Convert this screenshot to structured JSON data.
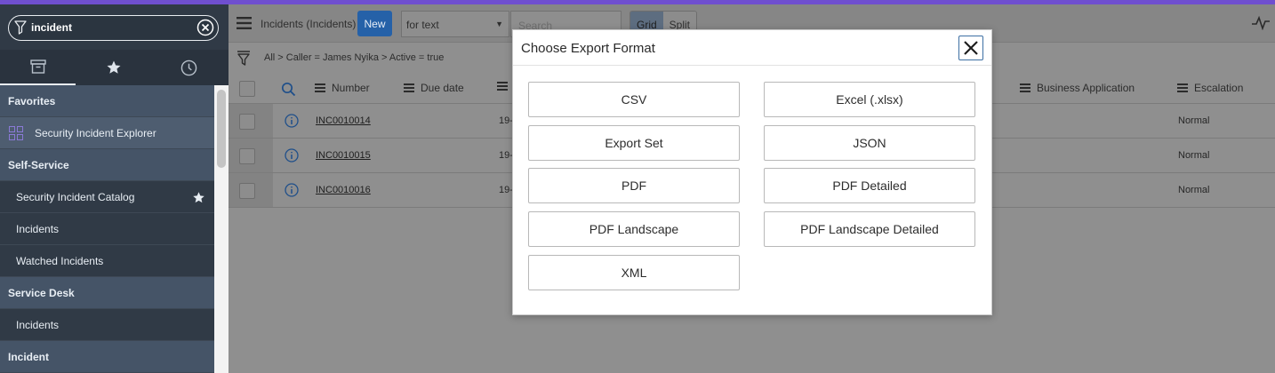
{
  "sidebar": {
    "filter_value": "incident",
    "tabs": [
      {
        "name": "all-apps",
        "icon": "archive-icon"
      },
      {
        "name": "favorites",
        "icon": "star-icon"
      },
      {
        "name": "history",
        "icon": "clock-icon"
      }
    ],
    "items": [
      {
        "label": "Favorites",
        "type": "section"
      },
      {
        "label": "Security Incident Explorer",
        "type": "item"
      },
      {
        "label": "Self-Service",
        "type": "section"
      },
      {
        "label": "Security Incident Catalog",
        "type": "item"
      },
      {
        "label": "Incidents",
        "type": "item"
      },
      {
        "label": "Watched Incidents",
        "type": "item"
      },
      {
        "label": "Service Desk",
        "type": "section"
      },
      {
        "label": "Incidents",
        "type": "item"
      },
      {
        "label": "Incident",
        "type": "section"
      }
    ]
  },
  "toolbar": {
    "list_title": "Incidents (Incidents)",
    "new_label": "New",
    "search_field": "for text",
    "search_placeholder": "Search",
    "view_grid": "Grid",
    "view_split": "Split"
  },
  "breadcrumb": "All > Caller = James Nyika > Active = true",
  "table": {
    "columns": [
      "Number",
      "Due date",
      "Business Application",
      "Escalation"
    ],
    "rows": [
      {
        "number": "INC0010014",
        "due": "19-",
        "escalation": "Normal"
      },
      {
        "number": "INC0010015",
        "due": "19-",
        "escalation": "Normal"
      },
      {
        "number": "INC0010016",
        "due": "19-",
        "escalation": "Normal"
      }
    ]
  },
  "modal": {
    "title": "Choose Export Format",
    "formats": [
      "CSV",
      "Excel (.xlsx)",
      "Export Set",
      "JSON",
      "PDF",
      "PDF Detailed",
      "PDF Landscape",
      "PDF Landscape Detailed",
      "XML"
    ]
  },
  "colors": {
    "accent": "#6f4fcf",
    "sidebar_bg": "#303a46",
    "new_button": "#2561a8",
    "close_border": "#3d6fa3"
  }
}
